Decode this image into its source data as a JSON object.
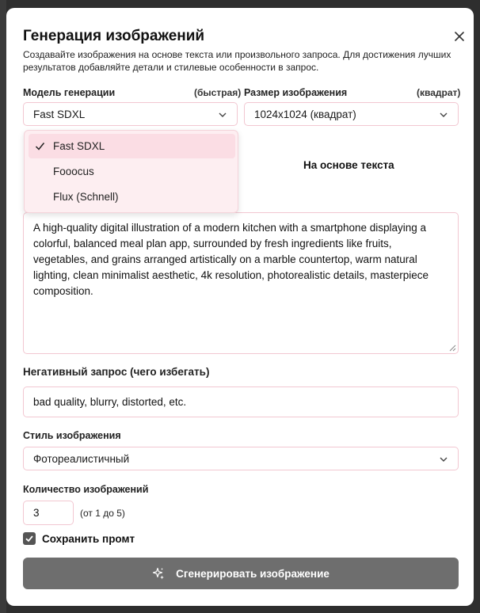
{
  "dialog": {
    "title": "Генерация изображений",
    "subtitle": "Создавайте изображения на основе текста или произвольного запроса. Для достижения лучших результатов добавляйте детали и стилевые особенности в запрос."
  },
  "model": {
    "label": "Модель генерации",
    "hint": "(быстрая)",
    "selected": "Fast SDXL",
    "options": [
      "Fast SDXL",
      "Fooocus",
      "Flux (Schnell)"
    ]
  },
  "size": {
    "label": "Размер изображения",
    "hint": "(квадрат)",
    "selected": "1024x1024 (квадрат)"
  },
  "tab": {
    "active_label": "На основе текста"
  },
  "prompt": {
    "value": "A high-quality digital illustration of a modern kitchen with a smartphone displaying a colorful, balanced meal plan app, surrounded by fresh ingredients like fruits, vegetables, and grains arranged artistically on a marble countertop, warm natural lighting, clean minimalist aesthetic, 4k resolution, photorealistic details, masterpiece composition."
  },
  "negative": {
    "label": "Негативный запрос (чего избегать)",
    "value": "bad quality, blurry, distorted, etc."
  },
  "style": {
    "label": "Стиль изображения",
    "selected": "Фотореалистичный"
  },
  "count": {
    "label": "Количество изображений",
    "value": "3",
    "range": "(от 1 до 5)"
  },
  "save_prompt": {
    "label": "Сохранить промт",
    "checked": true
  },
  "generate_button": {
    "label": "Сгенерировать изображение"
  },
  "colors": {
    "accent_border": "#f2c7d1",
    "dropdown_bg": "#fdeef1",
    "button_bg": "#6e6e6e"
  }
}
